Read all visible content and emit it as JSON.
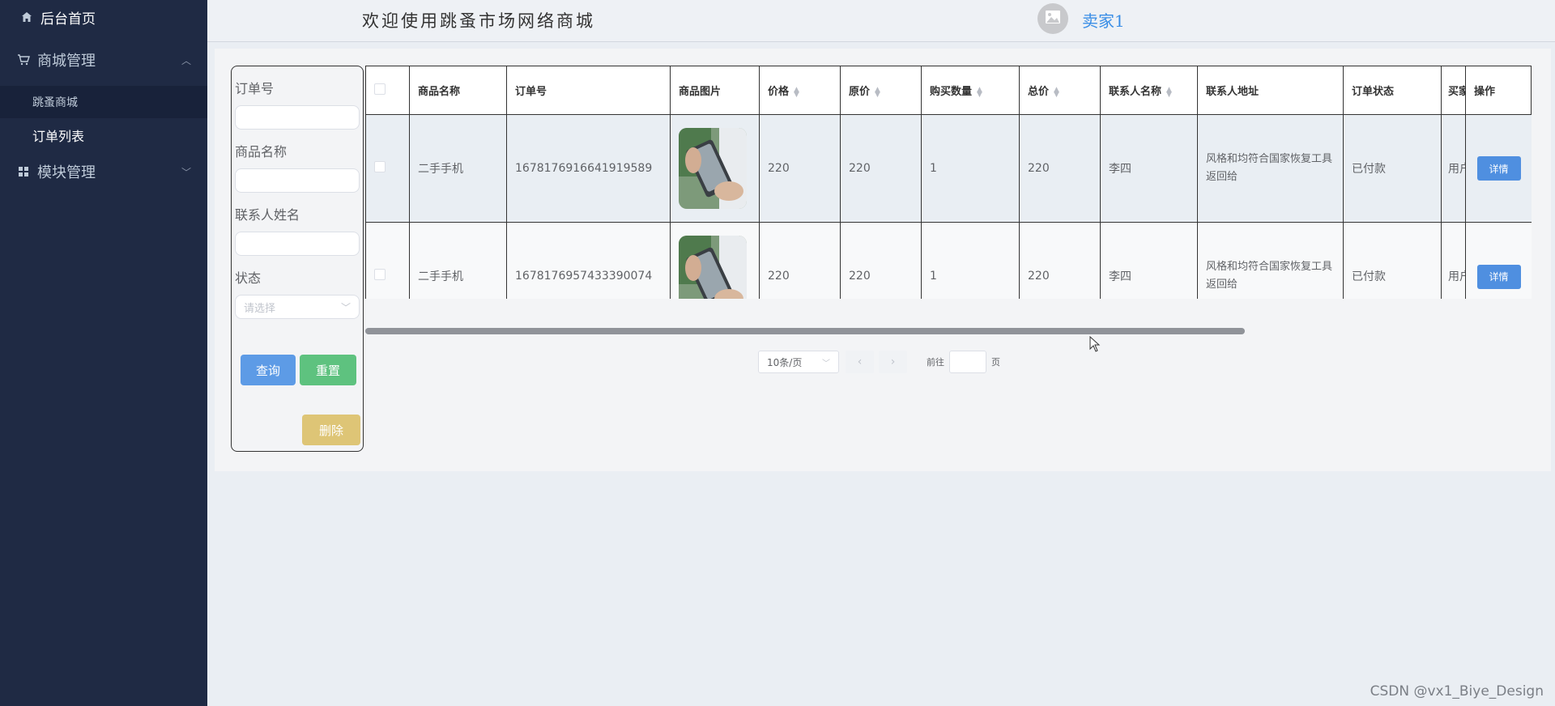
{
  "sidebar": {
    "home": "后台首页",
    "mall_mgmt": "商城管理",
    "sub_mall": "跳蚤商城",
    "sub_orders": "订单列表",
    "module_mgmt": "模块管理"
  },
  "header": {
    "welcome": "欢迎使用跳蚤市场网络商城",
    "username": "卖家1"
  },
  "filter": {
    "order_no_label": "订单号",
    "product_name_label": "商品名称",
    "contact_name_label": "联系人姓名",
    "status_label": "状态",
    "status_placeholder": "请选择",
    "query_btn": "查询",
    "reset_btn": "重置",
    "delete_btn": "删除"
  },
  "table": {
    "columns": [
      "商品名称",
      "订单号",
      "商品图片",
      "价格",
      "原价",
      "购买数量",
      "总价",
      "联系人名称",
      "联系人地址",
      "订单状态",
      "买家",
      "操作"
    ],
    "rows": [
      {
        "name": "二手手机",
        "order_no": "1678176916641919589",
        "price": "220",
        "original": "220",
        "qty": "1",
        "total": "220",
        "contact": "李四",
        "address": "风格和均符合国家恢复工具返回给",
        "status": "已付款",
        "buyer": "用户"
      },
      {
        "name": "二手手机",
        "order_no": "1678176957433390074",
        "price": "220",
        "original": "220",
        "qty": "1",
        "total": "220",
        "contact": "李四",
        "address": "风格和均符合国家恢复工具返回给",
        "status": "已付款",
        "buyer": "用户"
      }
    ],
    "detail_btn": "详情"
  },
  "pager": {
    "page_size": "10条/页",
    "goto_label": "前往",
    "page_unit": "页"
  },
  "watermark": "CSDN @vx1_Biye_Design"
}
